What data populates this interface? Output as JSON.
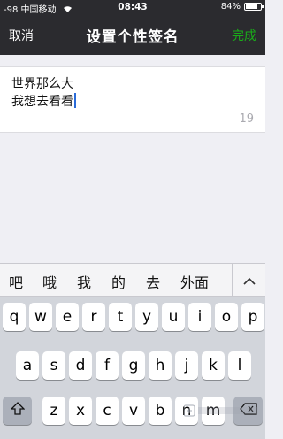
{
  "status_bar": {
    "signal": "-98",
    "carrier": "中国移动",
    "time": "08:43",
    "battery": "84%",
    "battery_level": 0.84
  },
  "nav": {
    "cancel_label": "取消",
    "title": "设置个性签名",
    "done_label": "完成"
  },
  "signature": {
    "line1": "世界那么大",
    "line2": "我想去看看",
    "remaining_count": "19"
  },
  "candidates": [
    "吧",
    "哦",
    "我",
    "的",
    "去",
    "外面"
  ],
  "keyboard": {
    "row1": [
      "q",
      "w",
      "e",
      "r",
      "t",
      "y",
      "u",
      "i",
      "o",
      "p"
    ],
    "row2": [
      "a",
      "s",
      "d",
      "f",
      "g",
      "h",
      "j",
      "k",
      "l"
    ],
    "row3": [
      "z",
      "x",
      "c",
      "v",
      "b",
      "n",
      "m"
    ]
  },
  "colors": {
    "nav_bg": "#2b2b2f",
    "done_green": "#1aad19",
    "caret_blue": "#2a6bd8"
  }
}
